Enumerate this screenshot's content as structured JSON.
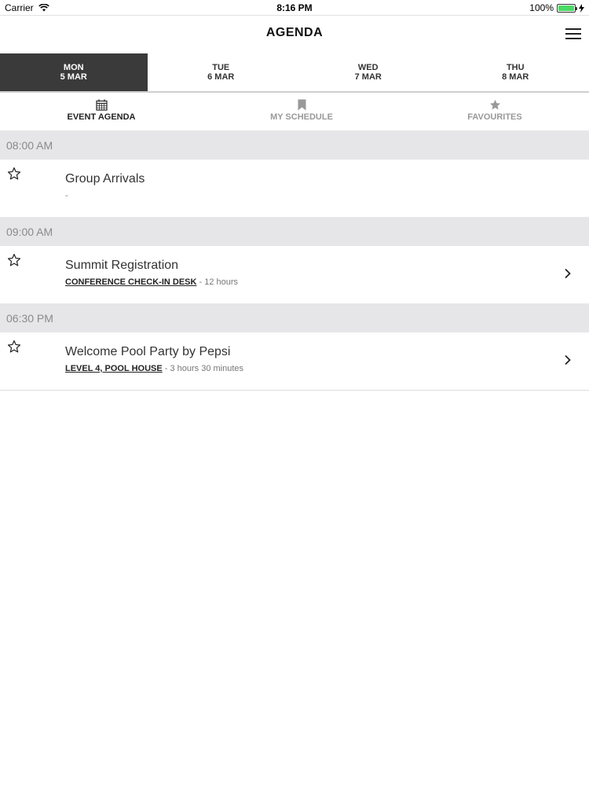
{
  "status_bar": {
    "carrier": "Carrier",
    "time": "8:16 PM",
    "battery": "100%",
    "battery_color": "#4cd964"
  },
  "navbar": {
    "title": "AGENDA",
    "menu_icon": "hamburger-menu-icon"
  },
  "day_tabs": [
    {
      "day": "MON",
      "date": "5 MAR",
      "active": true
    },
    {
      "day": "TUE",
      "date": "6 MAR",
      "active": false
    },
    {
      "day": "WED",
      "date": "7 MAR",
      "active": false
    },
    {
      "day": "THU",
      "date": "8 MAR",
      "active": false
    }
  ],
  "mode_tabs": [
    {
      "label": "EVENT AGENDA",
      "icon": "calendar-icon",
      "active": true
    },
    {
      "label": "MY SCHEDULE",
      "icon": "bookmark-icon",
      "active": false
    },
    {
      "label": "FAVOURITES",
      "icon": "star-filled-icon",
      "active": false
    }
  ],
  "agenda": [
    {
      "time": "08:00 AM",
      "title": "Group Arrivals",
      "location": "",
      "duration": "-",
      "has_chevron": false
    },
    {
      "time": "09:00 AM",
      "title": "Summit Registration",
      "location": "CONFERENCE CHECK-IN DESK",
      "duration": " - 12 hours",
      "has_chevron": true
    },
    {
      "time": "06:30 PM",
      "title": "Welcome Pool Party by Pepsi",
      "location": "LEVEL 4, POOL HOUSE",
      "duration": " - 3 hours 30 minutes",
      "has_chevron": true
    }
  ],
  "colors": {
    "active_tab_bg": "#3a3a3a",
    "time_header_bg": "#e6e6e8"
  }
}
